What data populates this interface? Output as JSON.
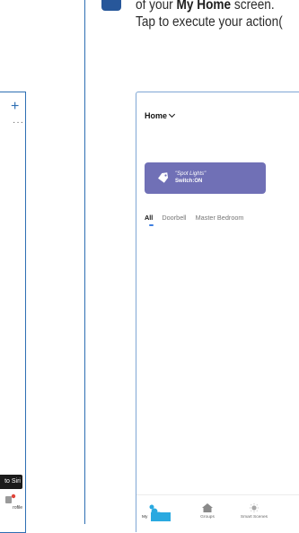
{
  "instruction": {
    "line1_prefix": "of your ",
    "line1_bold": "My Home",
    "line1_suffix": " screen.",
    "line2": "Tap to execute your action("
  },
  "left_phone": {
    "tooltip": "to Siri",
    "nav_label": "rofile"
  },
  "app": {
    "home_title": "Home",
    "scene": {
      "line1": "\"Spot Lights\"",
      "line2": "Switch:ON",
      "color": "#7070b6"
    },
    "tabs": [
      {
        "label": "All",
        "active": true
      },
      {
        "label": "Doorbell",
        "active": false
      },
      {
        "label": "Master Bedroom",
        "active": false
      }
    ],
    "bottom_nav": [
      {
        "label": "My",
        "icon": "my-home-icon"
      },
      {
        "label": "Groups",
        "icon": "home-icon"
      },
      {
        "label": "Smart Scenes",
        "icon": "sun-icon"
      }
    ]
  },
  "colors": {
    "accent_blue": "#2e6fb3",
    "step_square": "#27579a",
    "tab_indicator": "#3d7ee0"
  }
}
